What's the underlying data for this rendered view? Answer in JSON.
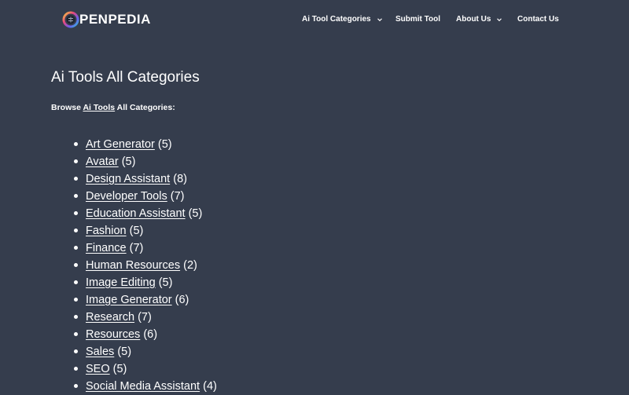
{
  "header": {
    "logo_text": "PENPEDIA",
    "nav": [
      {
        "label": "Ai Tool Categories",
        "has_dropdown": true
      },
      {
        "label": "Submit Tool",
        "has_dropdown": false
      },
      {
        "label": "About Us",
        "has_dropdown": true
      },
      {
        "label": "Contact Us",
        "has_dropdown": false
      }
    ]
  },
  "main": {
    "title": "Ai Tools All Categories",
    "intro": {
      "before": "Browse ",
      "link": "Ai Tools",
      "after": " All Categories:"
    },
    "categories": [
      {
        "name": "Art Generator",
        "count": "(5)"
      },
      {
        "name": "Avatar",
        "count": "(5)"
      },
      {
        "name": "Design Assistant",
        "count": "(8)"
      },
      {
        "name": "Developer Tools",
        "count": "(7)"
      },
      {
        "name": "Education Assistant",
        "count": "(5)"
      },
      {
        "name": "Fashion",
        "count": "(5)"
      },
      {
        "name": "Finance",
        "count": "(7)"
      },
      {
        "name": "Human Resources",
        "count": "(2)"
      },
      {
        "name": "Image Editing",
        "count": "(5)"
      },
      {
        "name": "Image Generator",
        "count": "(6)"
      },
      {
        "name": "Research",
        "count": "(7)"
      },
      {
        "name": "Resources",
        "count": "(6)"
      },
      {
        "name": "Sales",
        "count": "(5)"
      },
      {
        "name": "SEO",
        "count": "(5)"
      },
      {
        "name": "Social Media Assistant",
        "count": "(4)"
      }
    ]
  },
  "colors": {
    "background": "#353d4d",
    "text": "#ffffff"
  }
}
